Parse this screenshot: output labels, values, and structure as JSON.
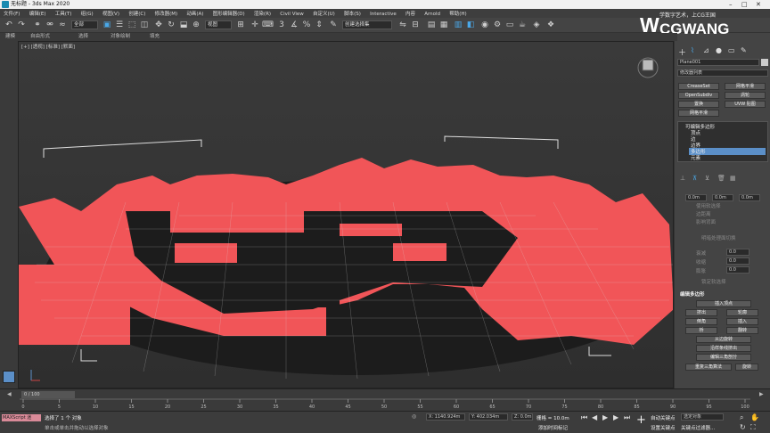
{
  "window": {
    "title": "无标题 - 3ds Max 2020"
  },
  "menu": [
    "文件(F)",
    "编辑(E)",
    "工具(T)",
    "组(G)",
    "视图(V)",
    "创建(C)",
    "修改器(M)",
    "动画(A)",
    "图形编辑器(D)",
    "渲染(R)",
    "Civil View",
    "自定义(U)",
    "脚本(S)",
    "Interactive",
    "内容",
    "Arnold",
    "帮助(H)"
  ],
  "toolbar": {
    "selection_filter": "全部",
    "view_dropdown": "视图",
    "named_selection": "创建选择集",
    "coord_label": "3"
  },
  "ribbon": {
    "items": [
      "建模",
      "自由形式",
      "选择",
      "对象绘制",
      "填充"
    ]
  },
  "viewport": {
    "label": "[+] [透视] [标准] [默面]"
  },
  "logo": {
    "brand": "CGWANG",
    "tagline": "学数字艺术，上CG王国",
    "sub": "传授CG技能 成就CG人才"
  },
  "cmd_panel": {
    "object_name": "Plane001",
    "modifier_list": "修改器列表",
    "buttons": [
      "CreaseSet",
      "网格平滑",
      "OpenSubdiv",
      "涡轮",
      "置换",
      "UVW 贴图",
      "网格平滑"
    ],
    "stack_title": "可编辑多边形",
    "stack_items": [
      "顶点",
      "边",
      "边界",
      "多边形",
      "元素"
    ],
    "stack_selected": "多边形",
    "soft_values": [
      "0.0m",
      "0.0m",
      "0.0m"
    ],
    "soft_labels": [
      "使用软选择",
      "边距离",
      "影响背面",
      "衰减",
      "收缩",
      "膨胀",
      "明暗处理面切换",
      "锁定软选择"
    ],
    "soft_field": "0.0",
    "edit_section": "编辑多边形",
    "edit_buttons": [
      "插入顶点",
      "挤出",
      "轮廓",
      "倒角",
      "插入",
      "桥",
      "翻转",
      "从边旋转",
      "沿样条线挤出",
      "编辑三角剖分",
      "重复三角算法",
      "旋转"
    ],
    "falloff_field": "0.0",
    "shrink_field": "0.0"
  },
  "timeline": {
    "frame": "0 / 100",
    "ticks": [
      "0",
      "5",
      "10",
      "15",
      "20",
      "25",
      "30",
      "35",
      "40",
      "45",
      "50",
      "55",
      "60",
      "65",
      "70",
      "75",
      "80",
      "85",
      "90",
      "95",
      "100"
    ]
  },
  "status": {
    "script": "MAXScript 迷",
    "selection": "选择了 1 个 对象",
    "hint": "单击或单击并拖动以选择对象",
    "x": "X: 1140.924m",
    "y": "Y: 402.034m",
    "z": "Z: 0.0m",
    "grid": "栅格 = 10.0m",
    "autokey": "自动关键点",
    "setkey": "设置关键点",
    "selected": "选定对象",
    "addtime": "添加时间标记",
    "filter": "关键点过滤器..."
  },
  "colors": {
    "red": "#f15558",
    "black": "#1a1a1a",
    "bg": "#444444",
    "accent": "#4aa8e8"
  }
}
